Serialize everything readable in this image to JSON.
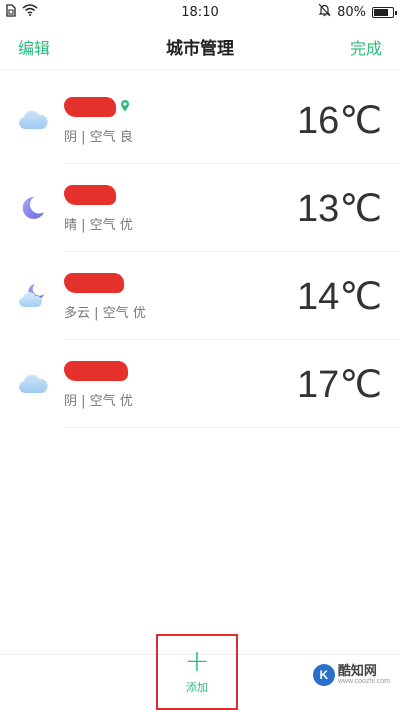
{
  "status_bar": {
    "time": "18:10",
    "battery_text": "80%",
    "battery_level": 0.8,
    "icons": [
      "sim-icon",
      "wifi-icon",
      "mute-bell-icon",
      "battery-icon"
    ]
  },
  "nav": {
    "edit_label": "编辑",
    "title": "城市管理",
    "done_label": "完成"
  },
  "cities": [
    {
      "name": "",
      "condition": "阴",
      "air_prefix": "空气",
      "air_quality": "良",
      "temperature": "16℃",
      "weather_icon": "cloud-icon",
      "location_marker": true
    },
    {
      "name": "",
      "condition": "晴",
      "air_prefix": "空气",
      "air_quality": "优",
      "temperature": "13℃",
      "weather_icon": "moon-icon",
      "location_marker": false
    },
    {
      "name": "",
      "condition": "多云",
      "air_prefix": "空气",
      "air_quality": "优",
      "temperature": "14℃",
      "weather_icon": "moon-cloud-icon",
      "location_marker": false
    },
    {
      "name": "",
      "condition": "阴",
      "air_prefix": "空气",
      "air_quality": "优",
      "temperature": "17℃",
      "weather_icon": "cloud-icon",
      "location_marker": false
    }
  ],
  "add": {
    "icon": "+",
    "label": "添加"
  },
  "watermark": {
    "logo_letter": "K",
    "name": "酷知网",
    "url": "www.coozhi.com"
  },
  "colors": {
    "accent": "#2dbb7c",
    "highlight_box": "#e02c2c",
    "redaction": "#e4312b"
  }
}
